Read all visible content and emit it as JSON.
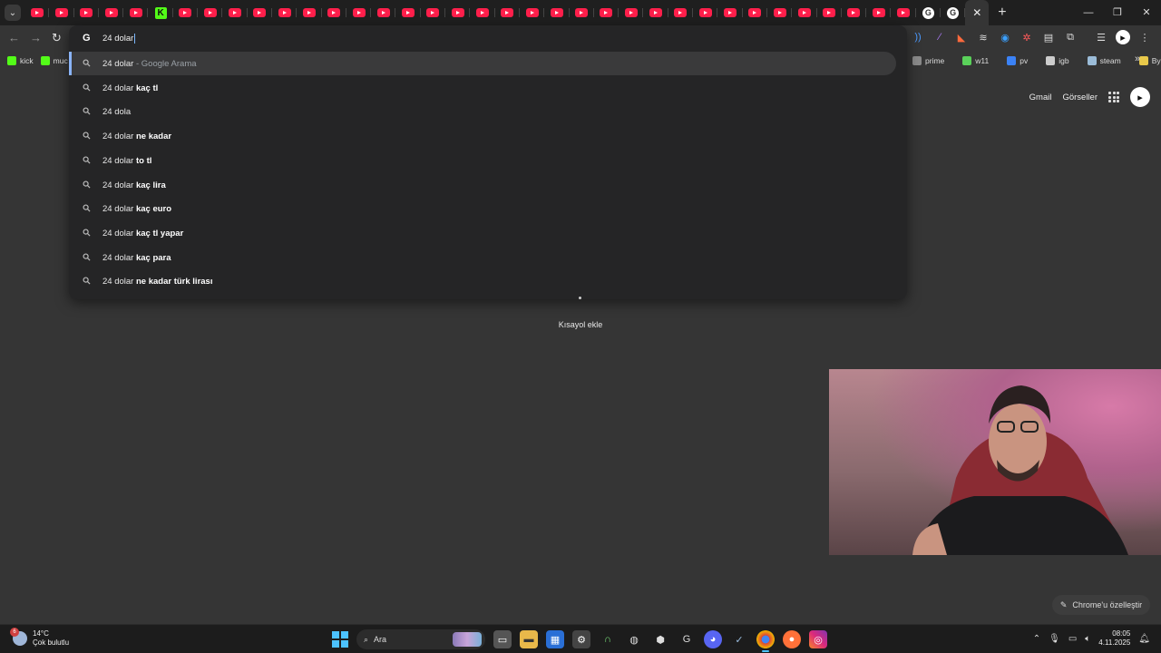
{
  "browser": {
    "active_tab_close": "✕",
    "newtab": "+",
    "window_controls": [
      "—",
      "❐",
      "✕"
    ]
  },
  "omnibox": {
    "value": "24 dolar",
    "suggestions": [
      {
        "base": "24 dolar",
        "bold": "",
        "extra": " - Google Arama"
      },
      {
        "base": "24 dolar ",
        "bold": "kaç tl",
        "extra": ""
      },
      {
        "base": "24 dola",
        "bold": "",
        "extra": ""
      },
      {
        "base": "24 dolar ",
        "bold": "ne kadar",
        "extra": ""
      },
      {
        "base": "24 dolar ",
        "bold": "to tl",
        "extra": ""
      },
      {
        "base": "24 dolar ",
        "bold": "kaç lira",
        "extra": ""
      },
      {
        "base": "24 dolar ",
        "bold": "kaç euro",
        "extra": ""
      },
      {
        "base": "24 dolar ",
        "bold": "kaç tl yapar",
        "extra": ""
      },
      {
        "base": "24 dolar ",
        "bold": "kaç para",
        "extra": ""
      },
      {
        "base": "24 dolar ",
        "bold": "ne kadar türk lirası",
        "extra": ""
      }
    ]
  },
  "bookmarks": {
    "left": [
      {
        "label": "kick",
        "color": "#53fc18"
      },
      {
        "label": "muc",
        "color": "#53fc18"
      }
    ],
    "right": [
      {
        "label": "prime",
        "color": "#8a8a8a"
      },
      {
        "label": "w11",
        "color": "#5ad15a"
      },
      {
        "label": "pv",
        "color": "#3b82f6"
      },
      {
        "label": "igb",
        "color": "#cccccc"
      },
      {
        "label": "steam",
        "color": "#9bbcd8"
      },
      {
        "label": "ByNo",
        "color": "#e8c84a"
      }
    ],
    "more": "»"
  },
  "google": {
    "gmail": "Gmail",
    "images": "Görseller"
  },
  "newtab": {
    "shortcut_label": "Kısayol ekle",
    "customize": "Chrome'u özelleştir"
  },
  "taskbar": {
    "temperature": "14°C",
    "weather": "Çok bulutlu",
    "weather_badge": "6",
    "search": "Ara",
    "time": "08:05",
    "date": "4.11.2025"
  }
}
